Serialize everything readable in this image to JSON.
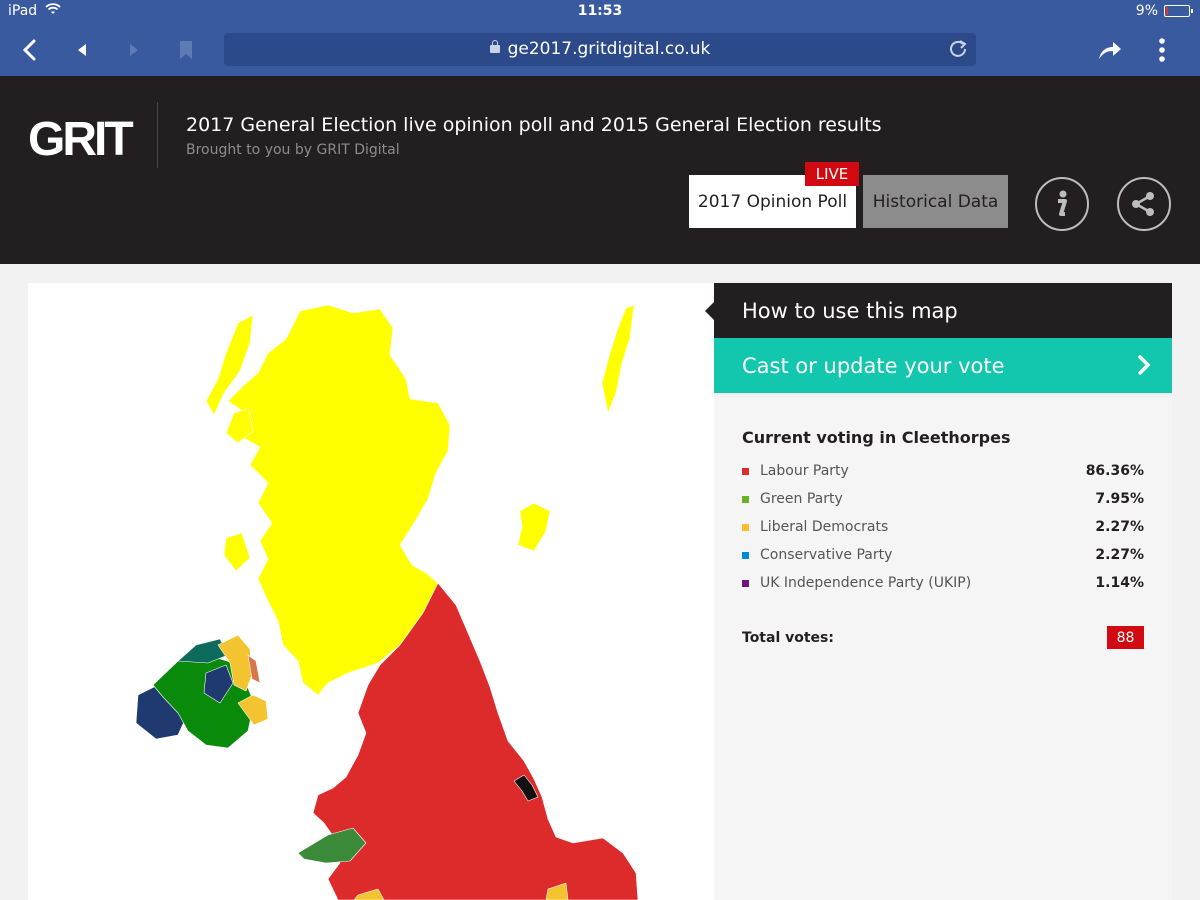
{
  "status_bar": {
    "device": "iPad",
    "time": "11:53",
    "battery": "9%",
    "battery_level": 0.09
  },
  "browser": {
    "url": "ge2017.gritdigital.co.uk"
  },
  "header": {
    "logo": "GRIT",
    "title": "2017 General Election live opinion poll and 2015 General Election results",
    "subtitle": "Brought to you by GRIT Digital",
    "tabs": {
      "opinion": "2017 Opinion Poll",
      "live": "LIVE",
      "historical": "Historical Data"
    }
  },
  "panel": {
    "how_to": "How to use this map",
    "cast_vote": "Cast or update your vote",
    "results_title": "Current voting in Cleethorpes",
    "parties": [
      {
        "name": "Labour Party",
        "pct": "86.36%",
        "color": "#dd2b2b"
      },
      {
        "name": "Green Party",
        "pct": "7.95%",
        "color": "#6ab023"
      },
      {
        "name": "Liberal Democrats",
        "pct": "2.27%",
        "color": "#fdbb30"
      },
      {
        "name": "Conservative Party",
        "pct": "2.27%",
        "color": "#0087dc"
      },
      {
        "name": "UK Independence Party (UKIP)",
        "pct": "1.14%",
        "color": "#70147a"
      }
    ],
    "total_label": "Total votes:",
    "total_value": "88"
  },
  "map": {
    "colors": {
      "scotland": "#ffff00",
      "labour": "#dd2b2b",
      "wales_green": "#3a8a3a",
      "ni_green": "#0a8a0a",
      "ni_navy": "#1f3a6e",
      "ni_teal": "#0d6b5e",
      "ni_yellow": "#f4c430",
      "selected": "#111111"
    }
  }
}
